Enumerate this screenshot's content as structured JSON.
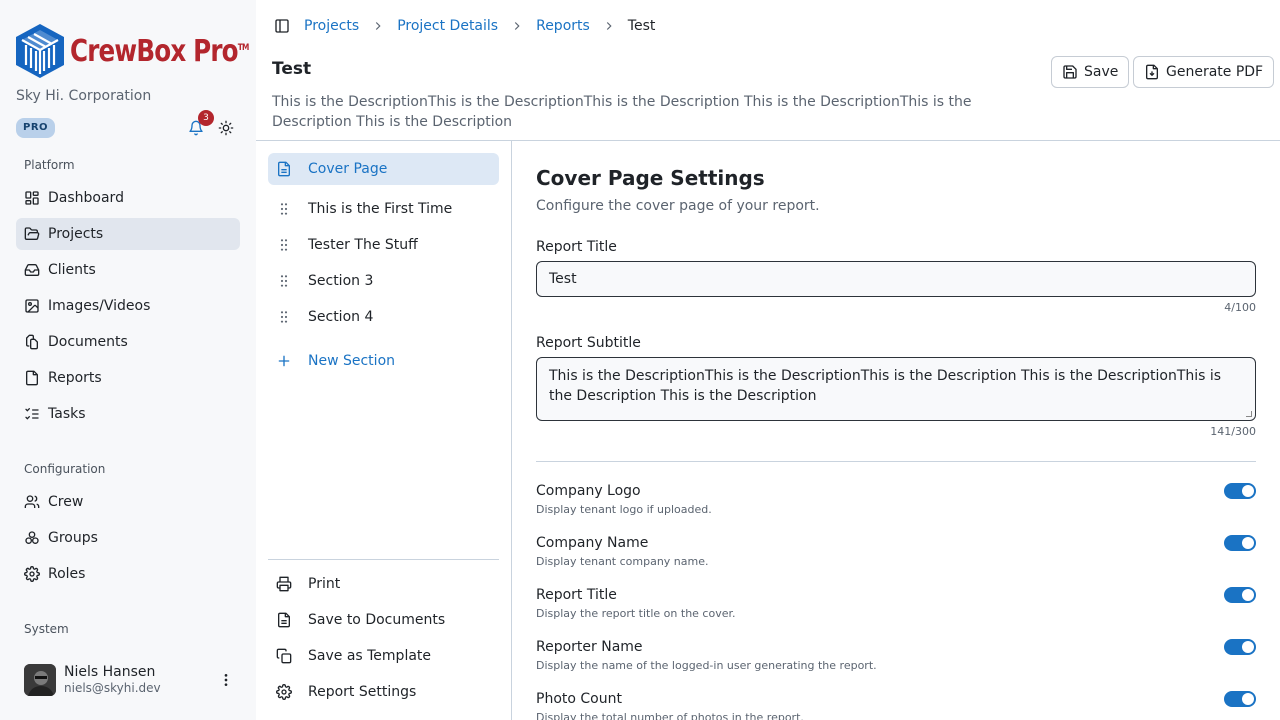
{
  "app": {
    "logo_text": "CrewBox Pro",
    "logo_tm": "TM",
    "company": "Sky Hi. Corporation",
    "plan_badge": "PRO",
    "notification_count": "3"
  },
  "sidebar": {
    "platform_label": "Platform",
    "platform_items": [
      {
        "label": "Dashboard",
        "icon": "dashboard-icon"
      },
      {
        "label": "Projects",
        "icon": "folder-icon",
        "active": true
      },
      {
        "label": "Clients",
        "icon": "clients-icon"
      },
      {
        "label": "Images/Videos",
        "icon": "image-icon"
      },
      {
        "label": "Documents",
        "icon": "documents-icon"
      },
      {
        "label": "Reports",
        "icon": "reports-icon"
      },
      {
        "label": "Tasks",
        "icon": "tasks-icon"
      }
    ],
    "config_label": "Configuration",
    "config_items": [
      {
        "label": "Crew",
        "icon": "users-icon"
      },
      {
        "label": "Groups",
        "icon": "groups-icon"
      },
      {
        "label": "Roles",
        "icon": "gear-icon"
      }
    ],
    "system_label": "System",
    "user": {
      "name": "Niels Hansen",
      "email": "niels@skyhi.dev"
    }
  },
  "breadcrumb": [
    "Projects",
    "Project Details",
    "Reports",
    "Test"
  ],
  "header": {
    "title": "Test",
    "description": "This is the DescriptionThis is the DescriptionThis is the Description This is the DescriptionThis is the Description This is the Description",
    "save_label": "Save",
    "pdf_label": "Generate PDF"
  },
  "sections": {
    "items": [
      "Cover Page",
      "This is the First Time",
      "Tester The Stuff",
      "Section 3",
      "Section 4"
    ],
    "new_section": "New Section",
    "actions": [
      "Print",
      "Save to Documents",
      "Save as Template",
      "Report Settings"
    ]
  },
  "settings": {
    "title": "Cover Page Settings",
    "description": "Configure the cover page of your report.",
    "report_title_label": "Report Title",
    "report_title_value": "Test",
    "report_title_count": "4/100",
    "report_subtitle_label": "Report Subtitle",
    "report_subtitle_value": "This is the DescriptionThis is the DescriptionThis is the Description This is the DescriptionThis is the Description This is the Description",
    "report_subtitle_count": "141/300",
    "toggles": [
      {
        "label": "Company Logo",
        "desc": "Display tenant logo if uploaded.",
        "on": true
      },
      {
        "label": "Company Name",
        "desc": "Display tenant company name.",
        "on": true
      },
      {
        "label": "Report Title",
        "desc": "Display the report title on the cover.",
        "on": true
      },
      {
        "label": "Reporter Name",
        "desc": "Display the name of the logged-in user generating the report.",
        "on": true
      },
      {
        "label": "Photo Count",
        "desc": "Display the total number of photos in the report.",
        "on": true
      }
    ]
  },
  "colors": {
    "brand": "#b3262d",
    "accent": "#1a73c4",
    "logo_blue": "#1565c0"
  }
}
